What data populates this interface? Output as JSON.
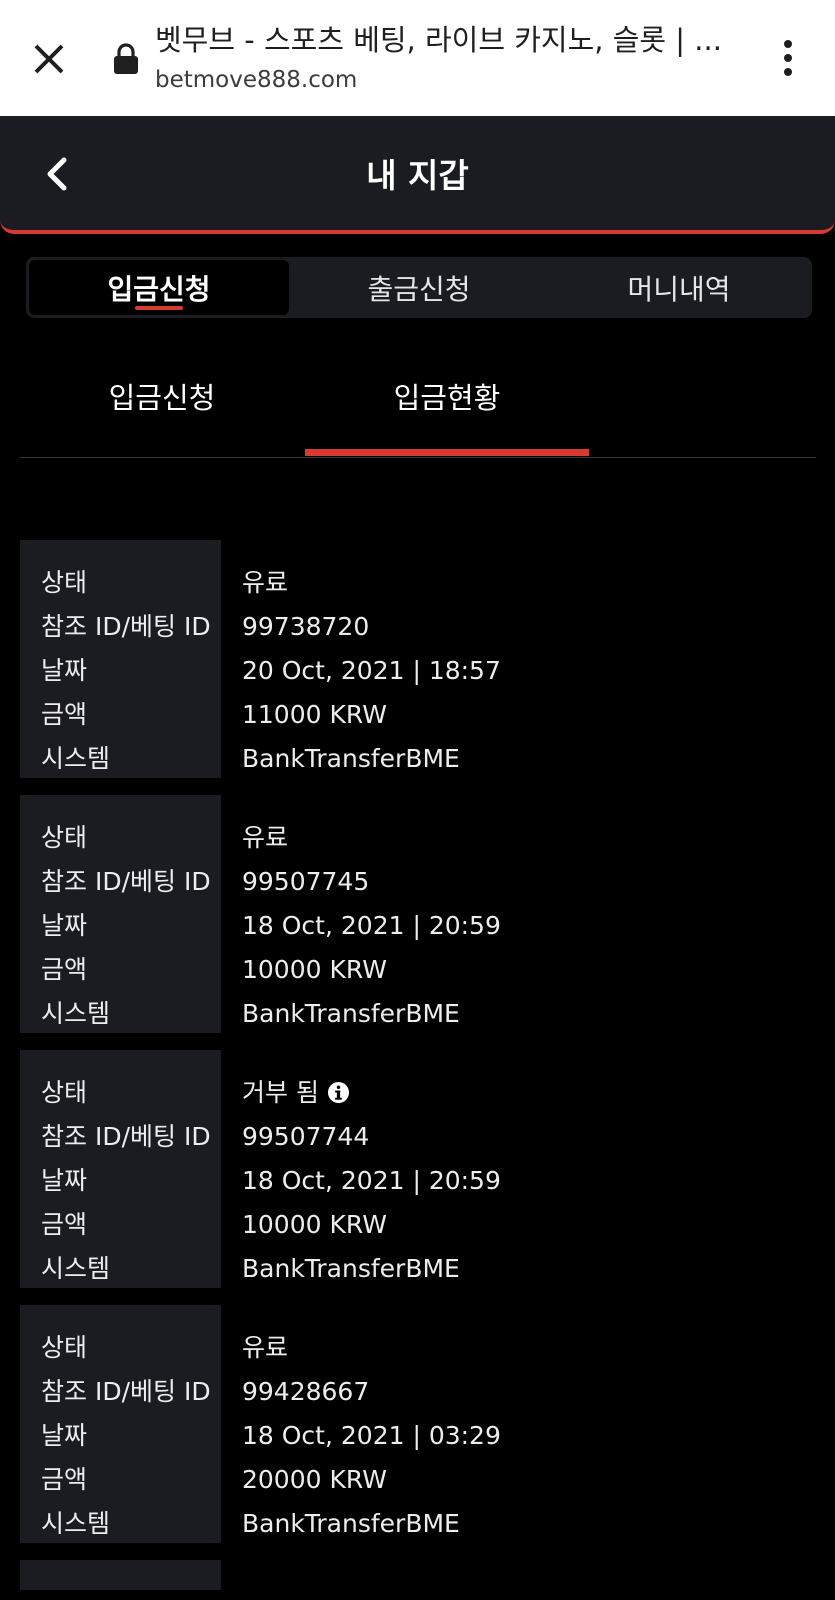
{
  "browser": {
    "page_title": "벳무브 - 스포츠 베팅, 라이브 카지노, 슬롯 | ...",
    "url": "betmove888.com"
  },
  "header": {
    "title": "내 지갑"
  },
  "main_tabs": [
    {
      "label": "입금신청",
      "active": true
    },
    {
      "label": "출금신청",
      "active": false
    },
    {
      "label": "머니내역",
      "active": false
    }
  ],
  "sub_tabs": [
    {
      "label": "입금신청",
      "active": false
    },
    {
      "label": "입금현황",
      "active": true
    }
  ],
  "field_labels": {
    "status": "상태",
    "ref_id": "참조 ID/베팅 ID",
    "date": "날짜",
    "amount": "금액",
    "system": "시스템"
  },
  "transactions": [
    {
      "status": "유료",
      "ref_id": "99738720",
      "date": "20 Oct, 2021 | 18:57",
      "amount": "11000 KRW",
      "system": "BankTransferBME"
    },
    {
      "status": "유료",
      "ref_id": "99507745",
      "date": "18 Oct, 2021 | 20:59",
      "amount": "10000 KRW",
      "system": "BankTransferBME"
    },
    {
      "status": "거부 됨",
      "ref_id": "99507744",
      "date": "18 Oct, 2021 | 20:59",
      "amount": "10000 KRW",
      "system": "BankTransferBME"
    },
    {
      "status": "유료",
      "ref_id": "99428667",
      "date": "18 Oct, 2021 | 03:29",
      "amount": "20000 KRW",
      "system": "BankTransferBME"
    }
  ],
  "colors": {
    "accent": "#d73a30",
    "panel": "#1b1c21",
    "background": "#000000"
  }
}
